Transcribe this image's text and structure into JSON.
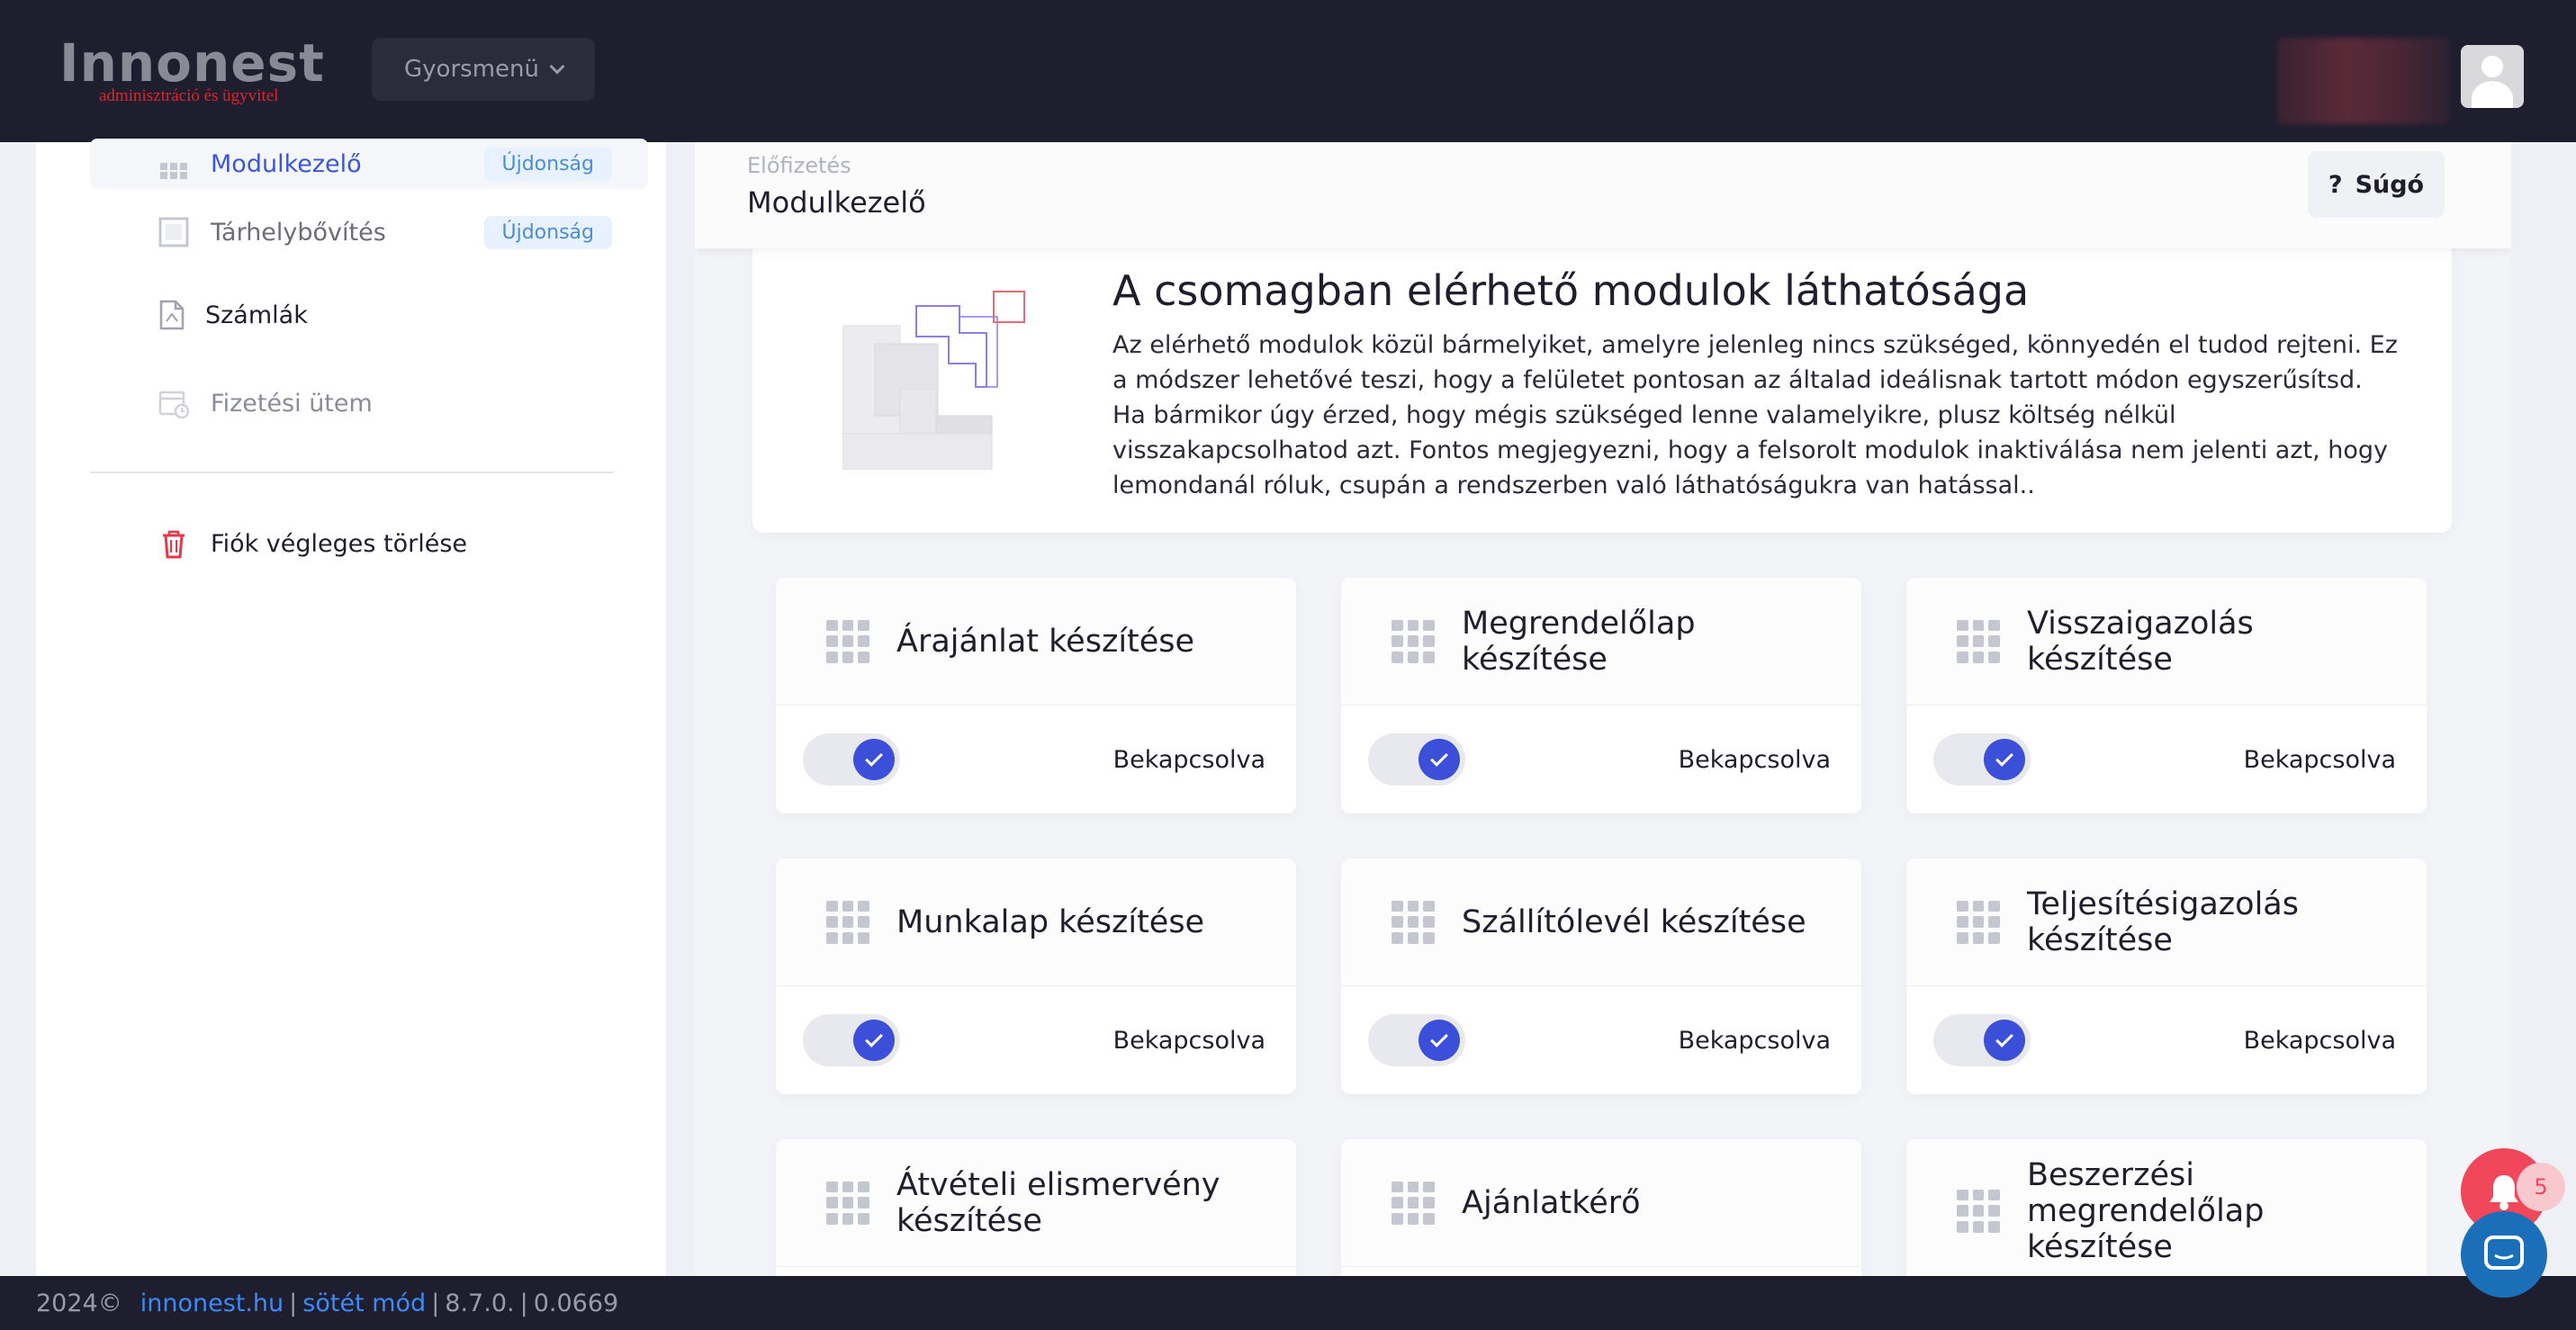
{
  "header": {
    "logo_brand": "Innonest",
    "logo_tagline": "adminisztráció és ügyvitel",
    "quick_menu_label": "Gyorsmenü"
  },
  "sidebar": {
    "items": [
      {
        "label": "Modulkezelő",
        "badge": "Újdonság",
        "icon": "grid-icon",
        "active": true
      },
      {
        "label": "Tárhelybővítés",
        "badge": "Újdonság",
        "icon": "storage-icon"
      },
      {
        "label": "Számlák",
        "icon": "pdf-file-icon"
      },
      {
        "label": "Fizetési ütem",
        "icon": "calendar-icon"
      }
    ],
    "delete_account_label": "Fiók végleges törlése"
  },
  "page": {
    "breadcrumb": "Előfizetés",
    "title": "Modulkezelő",
    "help_label": "Súgó",
    "help_icon": "?"
  },
  "info": {
    "title": "A csomagban elérhető modulok láthatósága",
    "text": "Az elérhető modulok közül bármelyiket, amelyre jelenleg nincs szükséged, könnyedén el tudod rejteni. Ez a módszer lehetővé teszi, hogy a felületet pontosan az általad ideálisnak tartott módon egyszerűsítsd. Ha bármikor úgy érzed, hogy mégis szükséged lenne valamelyikre, plusz költség nélkül visszakapcsolhatod azt. Fontos megjegyezni, hogy a felsorolt modulok inaktiválása nem jelenti azt, hogy lemondanál róluk, csupán a rendszerben való láthatóságukra van hatással.."
  },
  "modules": [
    {
      "title": "Árajánlat készítése",
      "status": "Bekapcsolva",
      "enabled": true
    },
    {
      "title": "Megrendelőlap készítése",
      "status": "Bekapcsolva",
      "enabled": true
    },
    {
      "title": "Visszaigazolás készítése",
      "status": "Bekapcsolva",
      "enabled": true
    },
    {
      "title": "Munkalap készítése",
      "status": "Bekapcsolva",
      "enabled": true
    },
    {
      "title": "Szállítólevél készítése",
      "status": "Bekapcsolva",
      "enabled": true
    },
    {
      "title": "Teljesítésigazolás készítése",
      "status": "Bekapcsolva",
      "enabled": true
    },
    {
      "title": "Átvételi elismervény készítése",
      "status": "",
      "enabled": true
    },
    {
      "title": "Ajánlatkérő",
      "status": "",
      "enabled": true
    },
    {
      "title": "Beszerzési megrendelőlap készítése",
      "status": "",
      "enabled": true
    }
  ],
  "footer": {
    "year": "2024©",
    "site_link": "innonest.hu",
    "sep1": "|",
    "dark_mode_link": "sötét mód",
    "sep2": "|",
    "version": "8.7.0.",
    "sep3": "|",
    "build": "0.0669"
  },
  "notifications": {
    "count": "5"
  },
  "colors": {
    "accent": "#3b4fd8",
    "topbar": "#1e1e2e",
    "danger": "#f0475a",
    "link": "#3d8af7"
  }
}
